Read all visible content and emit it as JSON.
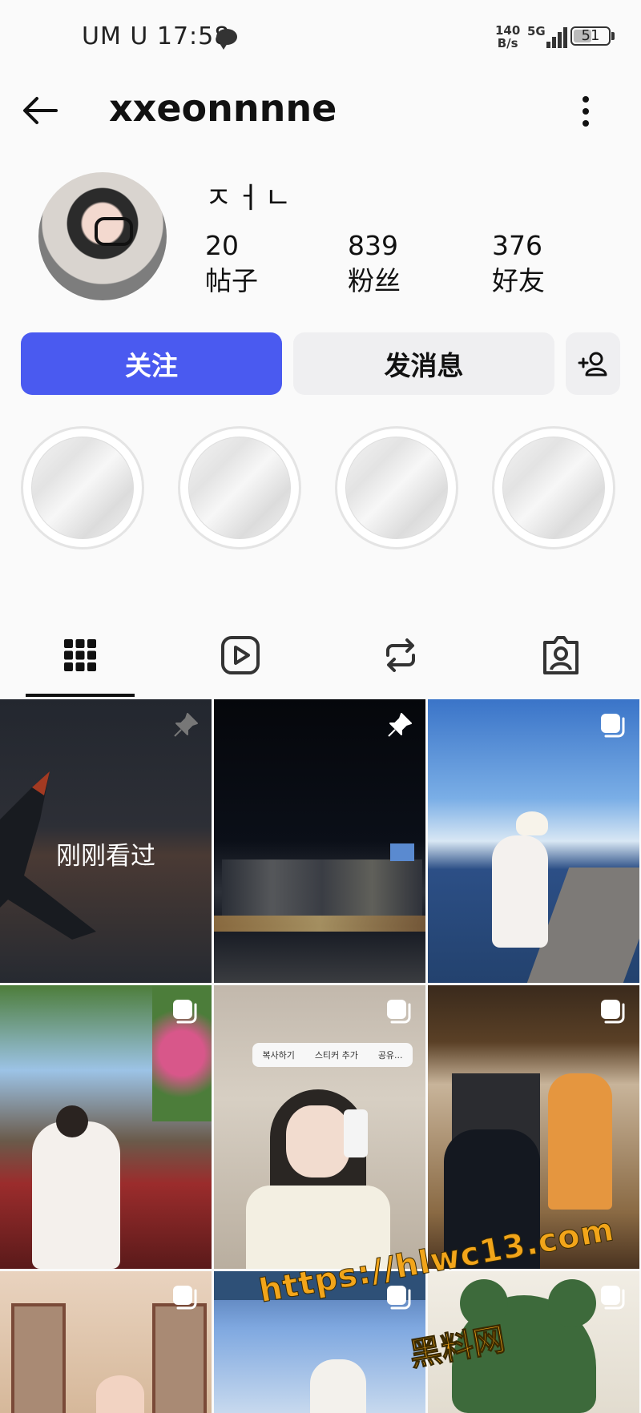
{
  "status_bar": {
    "time": "UM U 17:58",
    "net_speed": "140\nB/s",
    "network": "5G",
    "battery": "51"
  },
  "header": {
    "username": "xxeonnnne"
  },
  "profile": {
    "display_name": "ㅈㅓㄴ",
    "stats": [
      {
        "value": "20",
        "label": "帖子"
      },
      {
        "value": "839",
        "label": "粉丝"
      },
      {
        "value": "376",
        "label": "好友"
      }
    ]
  },
  "actions": {
    "follow": "关注",
    "message": "发消息"
  },
  "highlights_count": 4,
  "tabs": [
    "posts-grid",
    "reels",
    "reposts",
    "tagged"
  ],
  "grid": {
    "overlay_text": "刚刚看过",
    "tip_items": [
      "복사하기",
      "스티커 추가",
      "공유..."
    ]
  },
  "watermark": {
    "url": "https://hlwc13.com",
    "name": "黑料网"
  },
  "colors": {
    "accent": "#4a5af0",
    "secondary_button": "#efeff1"
  }
}
